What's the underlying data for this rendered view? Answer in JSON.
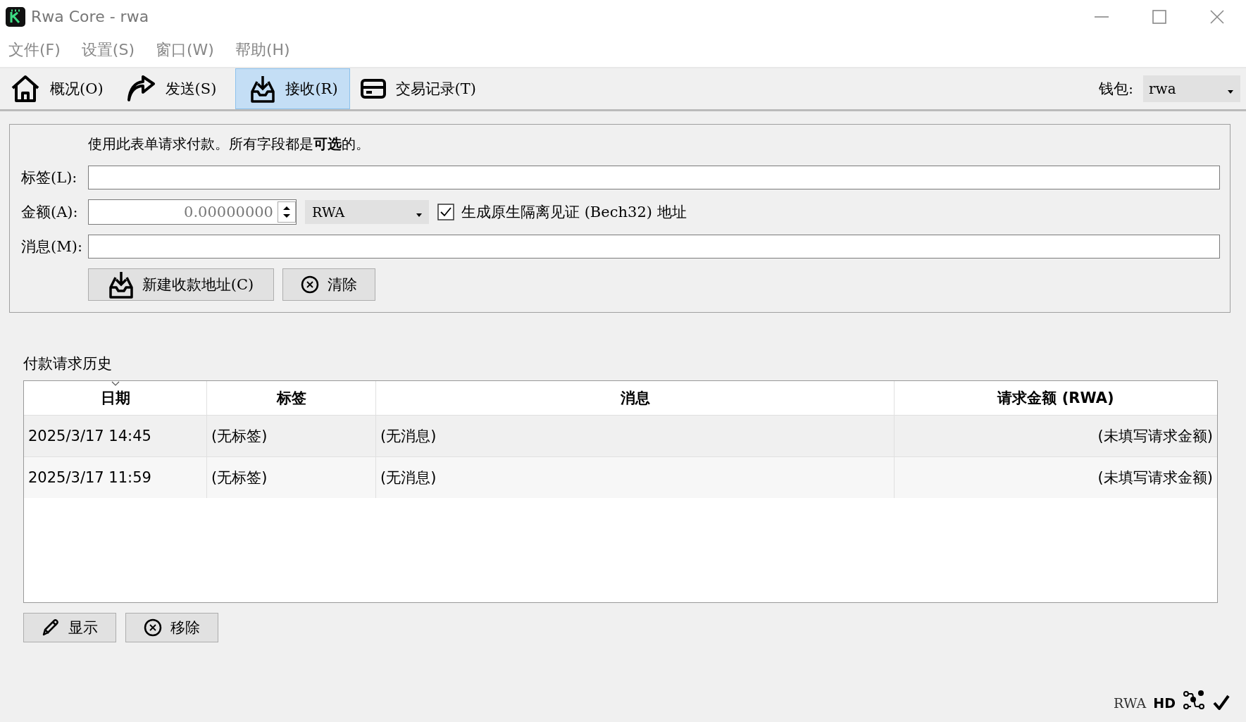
{
  "window": {
    "title": "Rwa Core - rwa"
  },
  "menu": [
    "文件(F)",
    "设置(S)",
    "窗口(W)",
    "帮助(H)"
  ],
  "tabs": [
    {
      "label": "概况(O)",
      "selected": false
    },
    {
      "label": "发送(S)",
      "selected": false
    },
    {
      "label": "接收(R)",
      "selected": true
    },
    {
      "label": "交易记录(T)",
      "selected": false
    }
  ],
  "wallet": {
    "label": "钱包:",
    "value": "rwa"
  },
  "form": {
    "intro": "使用此表单请求付款。所有字段都是**可选**的。",
    "label_field": {
      "label": "标签(L):"
    },
    "amount_field": {
      "label": "金额(A):",
      "value": "0.00000000",
      "unit": "RWA"
    },
    "bech32": {
      "label": "生成原生隔离见证 (Bech32) 地址",
      "checked": true
    },
    "message_field": {
      "label": "消息(M):"
    },
    "buttons": [
      {
        "label": "新建收款地址(C)"
      },
      {
        "label": "清除"
      }
    ]
  },
  "history": {
    "title": "付款请求历史",
    "columns": [
      {
        "label": "日期",
        "sorted": true
      },
      {
        "label": "标签",
        "sorted": false
      },
      {
        "label": "消息",
        "sorted": false
      },
      {
        "label": "请求金额 (RWA)",
        "sorted": false
      }
    ],
    "rows": [
      [
        "2025/3/17 14:45",
        "(无标签)",
        "(无消息)",
        "(未填写请求金额)"
      ],
      [
        "2025/3/17 11:59",
        "(无标签)",
        "(无消息)",
        "(未填写请求金额)"
      ]
    ],
    "buttons": [
      {
        "label": "显示"
      },
      {
        "label": "移除"
      }
    ]
  },
  "status_bar": {
    "unit": "RWA",
    "hd": "HD"
  }
}
